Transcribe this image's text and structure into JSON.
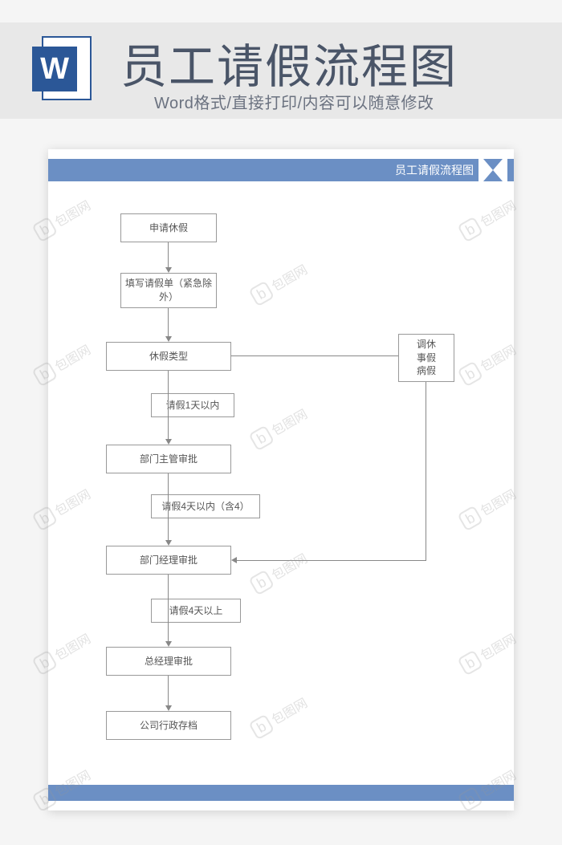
{
  "header": {
    "word_letter": "W",
    "title": "员工请假流程图",
    "subtitle": "Word格式/直接打印/内容可以随意修改"
  },
  "doc": {
    "header_label": "员工请假流程图"
  },
  "nodes": {
    "n1": "申请休假",
    "n2": "填写请假单（紧急除外）",
    "n3": "休假类型",
    "n4": "请假1天以内",
    "n5": "部门主管审批",
    "n6": "请假4天以内（含4）",
    "n7": "部门经理审批",
    "n8": "请假4天以上",
    "n9": "总经理审批",
    "n10": "公司行政存档",
    "side": "调休\n事假\n病假"
  },
  "watermark": {
    "text": "包图网"
  }
}
